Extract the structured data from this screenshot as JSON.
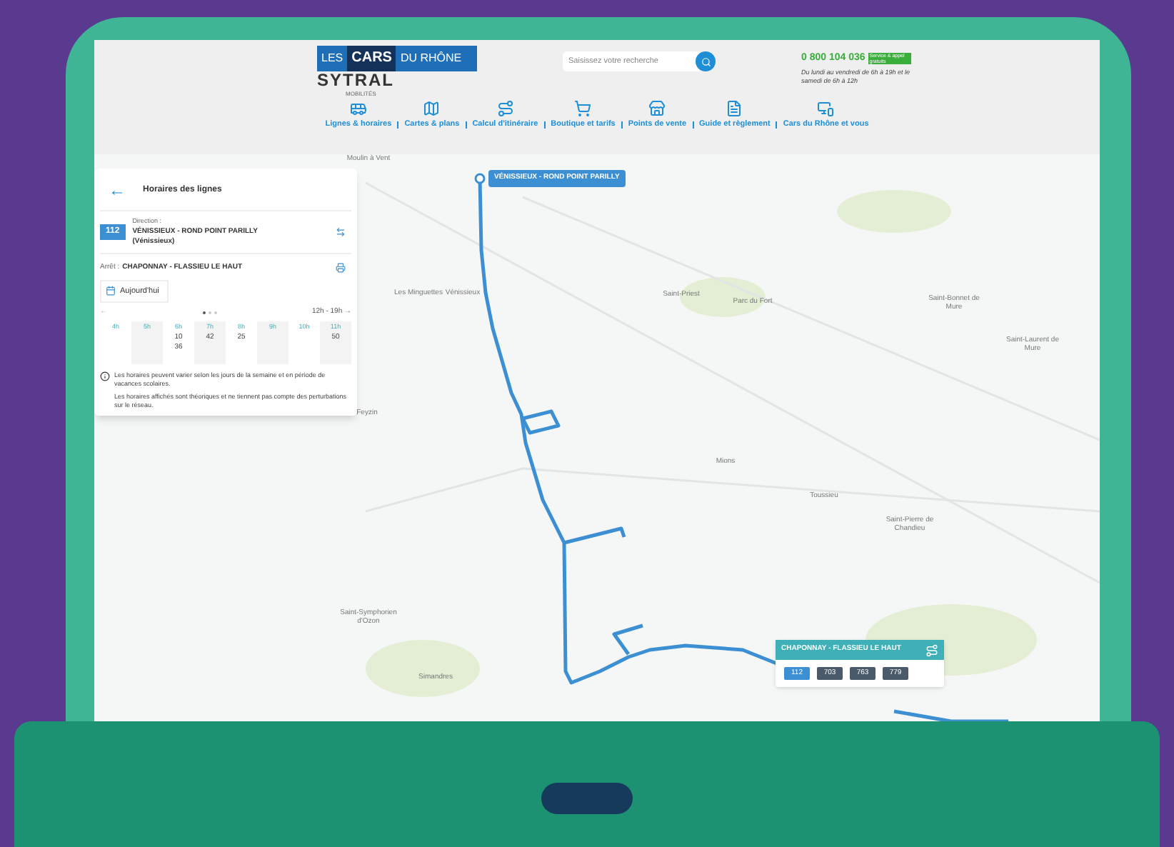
{
  "header": {
    "logo": {
      "left": "LES",
      "main": "CARS",
      "right": "DU RHÔNE",
      "sub": "SYTRAL",
      "sub2": "MOBILITÉS"
    },
    "search": {
      "placeholder": "Saisissez votre recherche"
    },
    "phone": {
      "number": "0 800 104 036",
      "badge": "Service & appel gratuits",
      "hours": "Du lundi au vendredi de 6h à 19h et le samedi de 6h à 12h"
    }
  },
  "nav": [
    {
      "label": "Lignes & horaires"
    },
    {
      "label": "Cartes & plans"
    },
    {
      "label": "Calcul d'itinéraire"
    },
    {
      "label": "Boutique et tarifs"
    },
    {
      "label": "Points de vente"
    },
    {
      "label": "Guide et règlement"
    },
    {
      "label": "Cars du Rhône et vous"
    }
  ],
  "panel": {
    "back": "←",
    "title": "Horaires des lignes",
    "line": {
      "number": "112",
      "direction_label": "Direction :",
      "direction": "VÉNISSIEUX - ROND POINT PARILLY",
      "town": "(Vénissieux)"
    },
    "stop_label": "Arrêt :",
    "stop": "CHAPONNAY - FLASSIEU LE HAUT",
    "date": "Aujourd'hui",
    "prev": "←",
    "range": "12h - 19h →",
    "pages": [
      {
        "selected": true
      },
      {
        "selected": false
      },
      {
        "selected": false
      }
    ],
    "timetable": [
      {
        "hour": "4h"
      },
      {
        "hour": "5h"
      },
      {
        "hour": "6h",
        "minutes": [
          "10",
          "36"
        ]
      },
      {
        "hour": "7h",
        "minutes": [
          "42"
        ]
      },
      {
        "hour": "8h",
        "minutes": [
          "25"
        ]
      },
      {
        "hour": "9h"
      },
      {
        "hour": "10h"
      },
      {
        "hour": "11h",
        "minutes": [
          "50"
        ]
      }
    ],
    "notes": [
      "Les horaires peuvent varier selon les jours de la semaine et en période de vacances scolaires.",
      "Les horaires affichés sont théoriques et ne tiennent pas compte des perturbations sur le réseau."
    ]
  },
  "map": {
    "places": [
      "Moulin à Vent",
      "Les Minguettes",
      "Vénissieux",
      "Saint-Priest",
      "Parc du Fort",
      "Saint-Bonnet de Mure",
      "Saint-Laurent de Mure",
      "Feyzin",
      "Mions",
      "Toussieu",
      "Saint-Pierre de Chandieu",
      "Saint-Symphorien d'Ozon",
      "Simandres"
    ],
    "start": "VÉNISSIEUX - ROND POINT PARILLY",
    "popup": {
      "stop": "CHAPONNAY - FLASSIEU LE HAUT",
      "lines": [
        {
          "number": "112",
          "selected": true
        },
        {
          "number": "703",
          "selected": false
        },
        {
          "number": "763",
          "selected": false
        },
        {
          "number": "779",
          "selected": false
        }
      ]
    }
  }
}
